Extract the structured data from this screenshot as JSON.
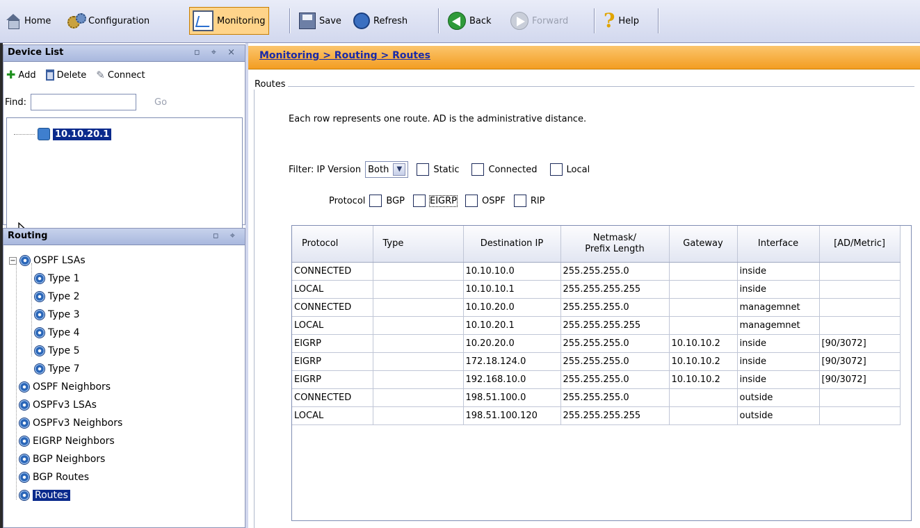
{
  "toolbar": {
    "home": "Home",
    "configuration": "Configuration",
    "monitoring": "Monitoring",
    "save": "Save",
    "refresh": "Refresh",
    "back": "Back",
    "forward": "Forward",
    "help": "Help"
  },
  "device_list": {
    "title": "Device List",
    "controls": "▫ ⌖ ×",
    "add": "Add",
    "delete": "Delete",
    "connect": "Connect",
    "find_label": "Find:",
    "find_value": "",
    "go": "Go",
    "device": "10.10.20.1"
  },
  "routing_panel": {
    "title": "Routing",
    "controls": "▫ ⌖",
    "ospf_lsas": "OSPF LSAs",
    "lsa_types": [
      "Type 1",
      "Type 2",
      "Type 3",
      "Type 4",
      "Type 5",
      "Type 7"
    ],
    "items": [
      "OSPF Neighbors",
      "OSPFv3 LSAs",
      "OSPFv3 Neighbors",
      "EIGRP Neighbors",
      "BGP Neighbors",
      "BGP Routes",
      "Routes"
    ]
  },
  "main": {
    "breadcrumb": "Monitoring > Routing > Routes",
    "group_title": "Routes",
    "description": "Each row represents one route. AD is the administrative distance.",
    "filter_label": "Filter: IP Version",
    "ip_version": "Both",
    "filters": [
      "Static",
      "Connected",
      "Local"
    ],
    "protocol_label": "Protocol",
    "protocols": [
      "BGP",
      "EIGRP",
      "OSPF",
      "RIP"
    ]
  },
  "table": {
    "headers": [
      "Protocol",
      "Type",
      "Destination IP",
      "Netmask/\nPrefix Length",
      "Gateway",
      "Interface",
      "[AD/Metric]"
    ],
    "rows": [
      [
        "CONNECTED",
        "",
        "10.10.10.0",
        "255.255.255.0",
        "",
        "inside",
        ""
      ],
      [
        "LOCAL",
        "",
        "10.10.10.1",
        "255.255.255.255",
        "",
        "inside",
        ""
      ],
      [
        "CONNECTED",
        "",
        "10.10.20.0",
        "255.255.255.0",
        "",
        "managemnet",
        ""
      ],
      [
        "LOCAL",
        "",
        "10.10.20.1",
        "255.255.255.255",
        "",
        "managemnet",
        ""
      ],
      [
        "EIGRP",
        "",
        "10.20.20.0",
        "255.255.255.0",
        "10.10.10.2",
        "inside",
        "[90/3072]"
      ],
      [
        "EIGRP",
        "",
        "172.18.124.0",
        "255.255.255.0",
        "10.10.10.2",
        "inside",
        "[90/3072]"
      ],
      [
        "EIGRP",
        "",
        "192.168.10.0",
        "255.255.255.0",
        "10.10.10.2",
        "inside",
        "[90/3072]"
      ],
      [
        "CONNECTED",
        "",
        "198.51.100.0",
        "255.255.255.0",
        "",
        "outside",
        ""
      ],
      [
        "LOCAL",
        "",
        "198.51.100.120",
        "255.255.255.255",
        "",
        "outside",
        ""
      ]
    ]
  },
  "colors": {
    "accent_orange": "#f39d22",
    "selection_blue": "#0a2a8c",
    "link_blue": "#1a2aa8"
  }
}
